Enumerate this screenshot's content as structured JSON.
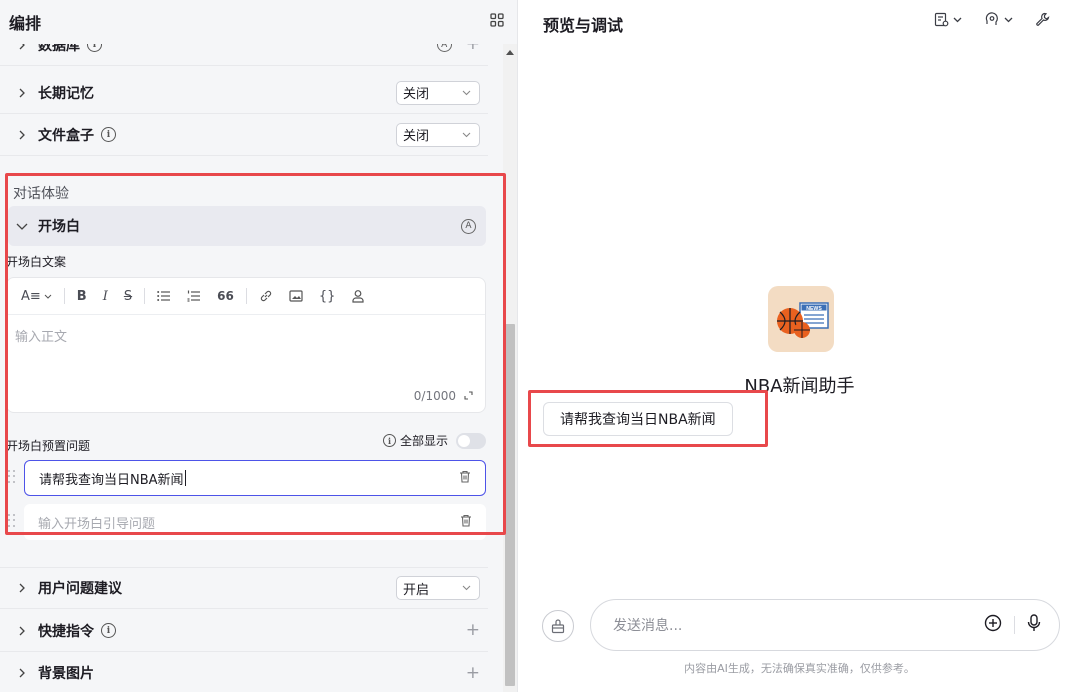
{
  "left_panel": {
    "title": "编排",
    "rows": [
      {
        "label": "数据库",
        "info": "i",
        "right_type": "plus",
        "badge": "A"
      },
      {
        "label": "长期记忆",
        "value": "关闭"
      },
      {
        "label": "文件盒子",
        "info": "i",
        "value": "关闭"
      }
    ],
    "section_title": "对话体验",
    "opening": {
      "header_label": "开场白",
      "badge": "A",
      "copy_label": "开场白文案",
      "editor_placeholder": "输入正文",
      "counter": "0/1000",
      "toolbar": {
        "text_style": "A≡",
        "bold": "B",
        "italic": "I",
        "strike": "S",
        "quote": "66",
        "code": "{}"
      },
      "preset_label": "开场白预置问题",
      "show_all_label": "全部显示",
      "show_all_enabled": false,
      "questions": [
        {
          "text": "请帮我查询当日NBA新闻",
          "placeholder": ""
        },
        {
          "text": "",
          "placeholder": "输入开场白引导问题"
        }
      ]
    },
    "bottom_rows": [
      {
        "label": "用户问题建议",
        "value": "开启"
      },
      {
        "label": "快捷指令",
        "info": "i",
        "right_type": "plus"
      },
      {
        "label": "背景图片",
        "right_type": "plus"
      }
    ]
  },
  "right_panel": {
    "title": "预览与调试",
    "bot_name": "NBA新闻助手",
    "avatar_badge": "NEWS",
    "suggested_question": "请帮我查询当日NBA新闻",
    "input_placeholder": "发送消息...",
    "disclaimer": "内容由AI生成，无法确保真实准确，仅供参考。"
  },
  "colors": {
    "accent": "#4d53e8",
    "highlight_box": "#e8484b",
    "panel_bg": "#f5f6f8"
  },
  "icons": {
    "layout": "grid-icon",
    "preview_tool_1": "document-settings-icon",
    "preview_tool_2": "brain-icon",
    "preview_tool_3": "wrench-icon"
  }
}
